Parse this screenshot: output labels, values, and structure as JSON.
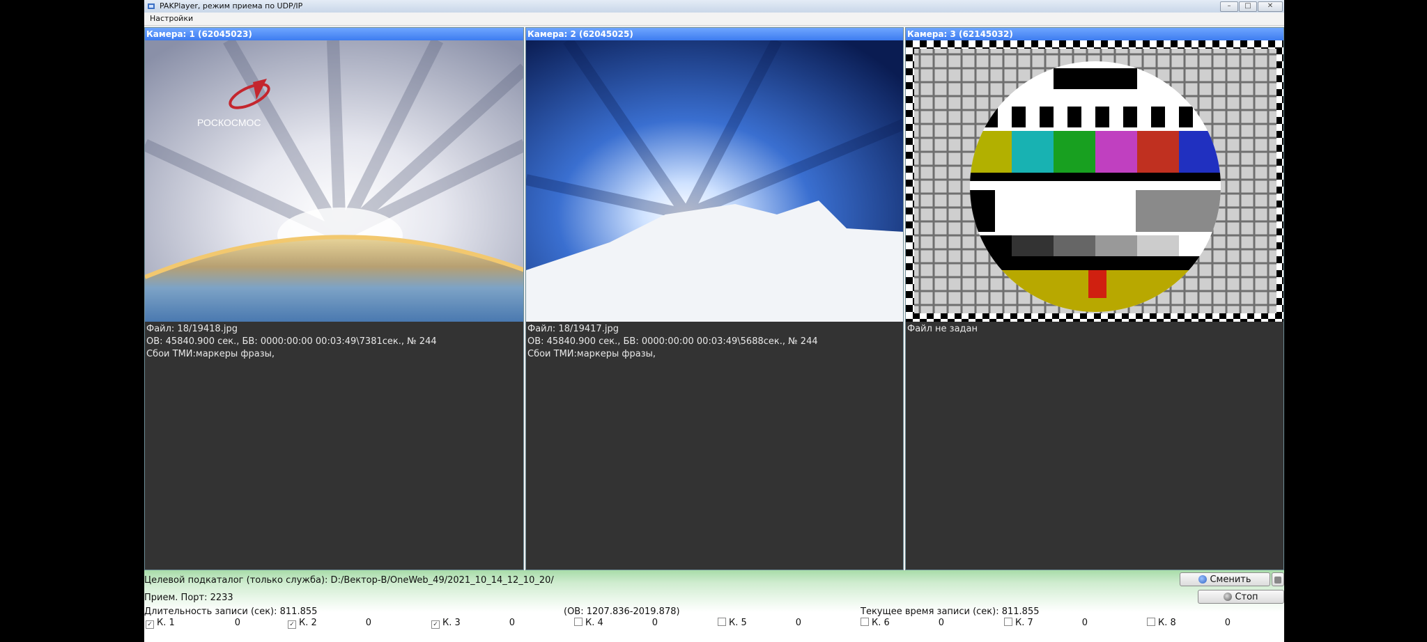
{
  "window": {
    "title": "PAKPlayer, режим приема по UDP/IP",
    "controls": [
      "–",
      "□",
      "✕"
    ]
  },
  "menu": {
    "settings": "Настройки"
  },
  "cameras": [
    {
      "header": "Камера: 1 (62045023)",
      "logo_text": "РОСКОСМОС",
      "file": "Файл: 18/19418.jpg",
      "ob": "ОВ: 45840.900 сек., БВ: 0000:00:00 00:03:49\\7381сек., № 244",
      "errors": "Сбои ТМИ:маркеры фразы,"
    },
    {
      "header": "Камера: 2 (62045025)",
      "file": "Файл: 18/19417.jpg",
      "ob": "ОВ: 45840.900 сек., БВ: 0000:00:00 00:03:49\\5688сек., № 244",
      "errors": "Сбои ТМИ:маркеры фразы,"
    },
    {
      "header": "Камера: 3 (62145032)",
      "file": "Файл не задан"
    }
  ],
  "status": {
    "target_dir": "Целевой подкаталог (только служба): D:/Вектор-В/OneWeb_49/2021_10_14_12_10_20/",
    "port": "Прием. Порт: 2233",
    "duration": "Длительность записи (сек): 811.855",
    "ob_range": "(ОВ: 1207.836-2019.878)",
    "current_time": "Текущее время записи (сек): 811.855",
    "change_button": "Сменить",
    "stop_button": "Стоп"
  },
  "channels": [
    {
      "label": "К. 1",
      "checked": true,
      "value": "0"
    },
    {
      "label": "К. 2",
      "checked": true,
      "value": "0"
    },
    {
      "label": "К. 3",
      "checked": true,
      "value": "0"
    },
    {
      "label": "К. 4",
      "checked": false,
      "value": "0"
    },
    {
      "label": "К. 5",
      "checked": false,
      "value": "0"
    },
    {
      "label": "К. 6",
      "checked": false,
      "value": "0"
    },
    {
      "label": "К. 7",
      "checked": false,
      "value": "0"
    },
    {
      "label": "К. 8",
      "checked": false,
      "value": "0"
    }
  ],
  "colors": {
    "panel_header": "#3d7cf0",
    "panel_bg": "#333333",
    "status_green": "#a8dca9"
  }
}
